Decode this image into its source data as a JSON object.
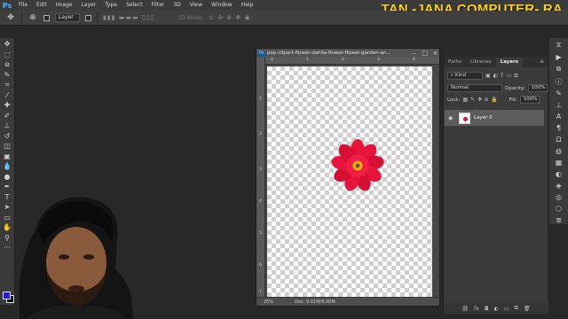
{
  "app": {
    "logo": "Ps"
  },
  "menu": [
    "File",
    "Edit",
    "Image",
    "Layer",
    "Type",
    "Select",
    "Filter",
    "3D",
    "View",
    "Window",
    "Help"
  ],
  "overlay_title": "TAN -JANA COMPUTER- RA",
  "options": {
    "auto_select_value": "Layer",
    "mode_3d_label": "3D Mode:"
  },
  "document": {
    "title": "pop-clipart-flower-dahlia-flower-flower-garden-an...",
    "close_symbol": "×",
    "ruler_top_ticks": [
      "0",
      "1",
      "2",
      "3",
      "4"
    ],
    "ruler_left_ticks": [
      "1",
      "2",
      "3",
      "4",
      "5",
      "6",
      "7"
    ],
    "zoom": "25%",
    "doc_size": "Doc: 9.01M/8.00M"
  },
  "panel": {
    "tabs": [
      "Paths",
      "Libraries",
      "Layers"
    ],
    "active_tab": "Layers",
    "kind_filter": "Kind",
    "blend_mode": "Normal",
    "opacity_label": "Opacity:",
    "opacity_value": "100%",
    "lock_label": "Lock:",
    "fill_label": "Fill:",
    "fill_value": "100%",
    "layers": [
      {
        "name": "Layer 0",
        "visible": true
      }
    ]
  },
  "colors": {
    "foreground": "#2b1be0",
    "background": "#111111",
    "accent": "#4fb3ff",
    "overlay_text": "#ffd400"
  }
}
